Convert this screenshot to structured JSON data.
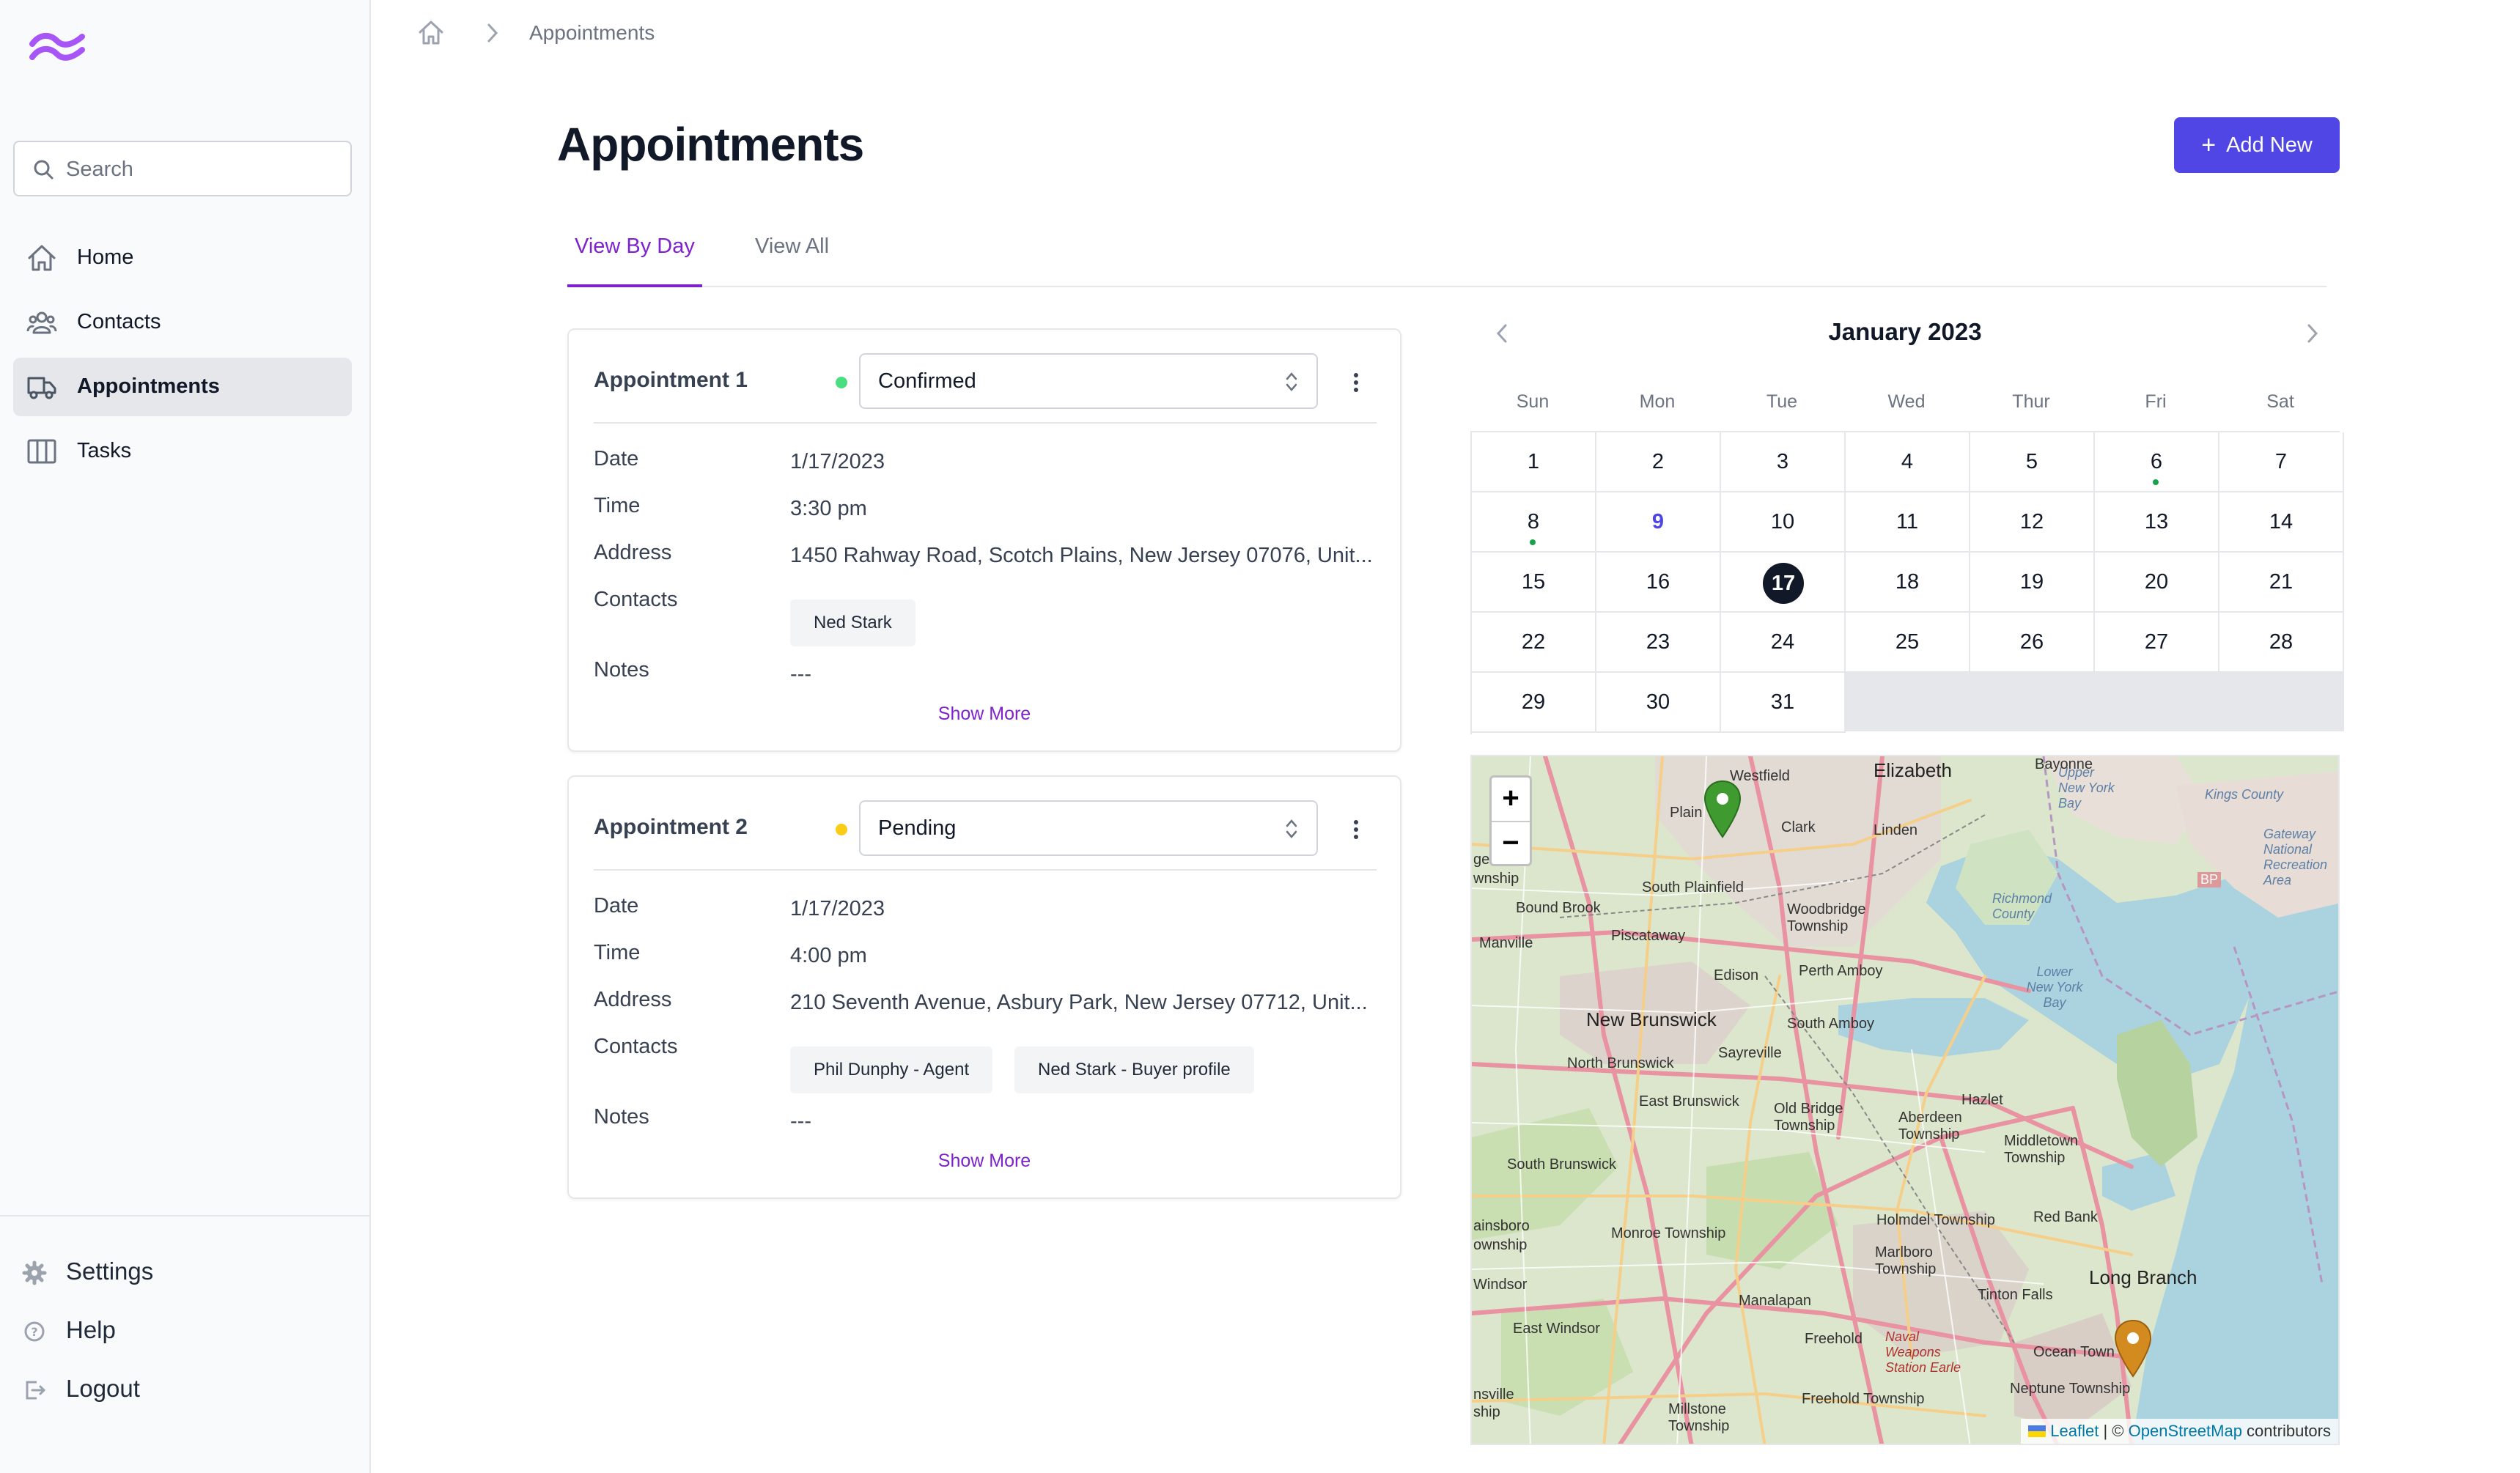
{
  "sidebar": {
    "search_placeholder": "Search",
    "nav": [
      {
        "label": "Home",
        "icon": "home-icon"
      },
      {
        "label": "Contacts",
        "icon": "users-icon"
      },
      {
        "label": "Appointments",
        "icon": "truck-icon",
        "active": true
      },
      {
        "label": "Tasks",
        "icon": "columns-icon"
      }
    ],
    "bottom": [
      {
        "label": "Settings",
        "icon": "gear-icon"
      },
      {
        "label": "Help",
        "icon": "help-icon"
      },
      {
        "label": "Logout",
        "icon": "logout-icon"
      }
    ]
  },
  "breadcrumb": {
    "current": "Appointments"
  },
  "header": {
    "title": "Appointments",
    "add_label": "Add New",
    "add_symbol": "+"
  },
  "tabs": [
    {
      "label": "View By Day",
      "active": true
    },
    {
      "label": "View All",
      "active": false
    }
  ],
  "labels": {
    "date": "Date",
    "time": "Time",
    "address": "Address",
    "contacts": "Contacts",
    "notes": "Notes",
    "show_more": "Show More"
  },
  "appointments": [
    {
      "title": "Appointment 1",
      "status": "Confirmed",
      "status_color": "#4ade80",
      "date": "1/17/2023",
      "time": "3:30 pm",
      "address": "1450 Rahway Road, Scotch Plains, New Jersey 07076, Unit...",
      "contacts": [
        "Ned Stark"
      ],
      "notes": "---"
    },
    {
      "title": "Appointment 2",
      "status": "Pending",
      "status_color": "#facc15",
      "date": "1/17/2023",
      "time": "4:00 pm",
      "address": "210 Seventh Avenue, Asbury Park, New Jersey 07712, Unit...",
      "contacts": [
        "Phil Dunphy - Agent",
        "Ned Stark - Buyer profile"
      ],
      "notes": "---"
    }
  ],
  "calendar": {
    "month_label": "January 2023",
    "weekdays": [
      "Sun",
      "Mon",
      "Tue",
      "Wed",
      "Thur",
      "Fri",
      "Sat"
    ],
    "first_weekday": 0,
    "days_in_month": 31,
    "today": 17,
    "highlight": 9,
    "event_days": [
      6,
      8
    ]
  },
  "map": {
    "zoom_in": "+",
    "zoom_out": "−",
    "attribution_leaflet": "Leaflet",
    "attribution_sep": " | © ",
    "attribution_osm": "OpenStreetMap",
    "attribution_tail": " contributors",
    "place_labels": [
      "Westfield",
      "Elizabeth",
      "Bayonne",
      "Clark",
      "Linden",
      "Plain",
      "Upper New York Bay",
      "Kings County",
      "Gateway National Recreation Area",
      "BP",
      "gewater",
      "wnship",
      "South Plainfield",
      "Bound Brook",
      "Woodbridge Township",
      "Richmond County",
      "Manville",
      "Piscataway",
      "Edison",
      "Perth Amboy",
      "Lower New York Bay",
      "New Brunswick",
      "South Amboy",
      "North Brunswick",
      "Sayreville",
      "East Brunswick",
      "Old Bridge Township",
      "Aberdeen Township",
      "Hazlet",
      "Middletown Township",
      "South Brunswick",
      "Holmdel Township",
      "Red Bank",
      "Monroe Township",
      "Marlboro Township",
      "Long Branch",
      "Manalapan",
      "Tinton Falls",
      "East Windsor",
      "Freehold",
      "Naval Weapons Station Earle",
      "Ocean Town",
      "Neptune Township",
      "Millstone Township",
      "Freehold Township",
      "ainsboro",
      "ownship",
      "Windsor",
      "nsville",
      "ship"
    ],
    "pin_colors": [
      "#3f9a2f",
      "#d38b1f"
    ]
  }
}
